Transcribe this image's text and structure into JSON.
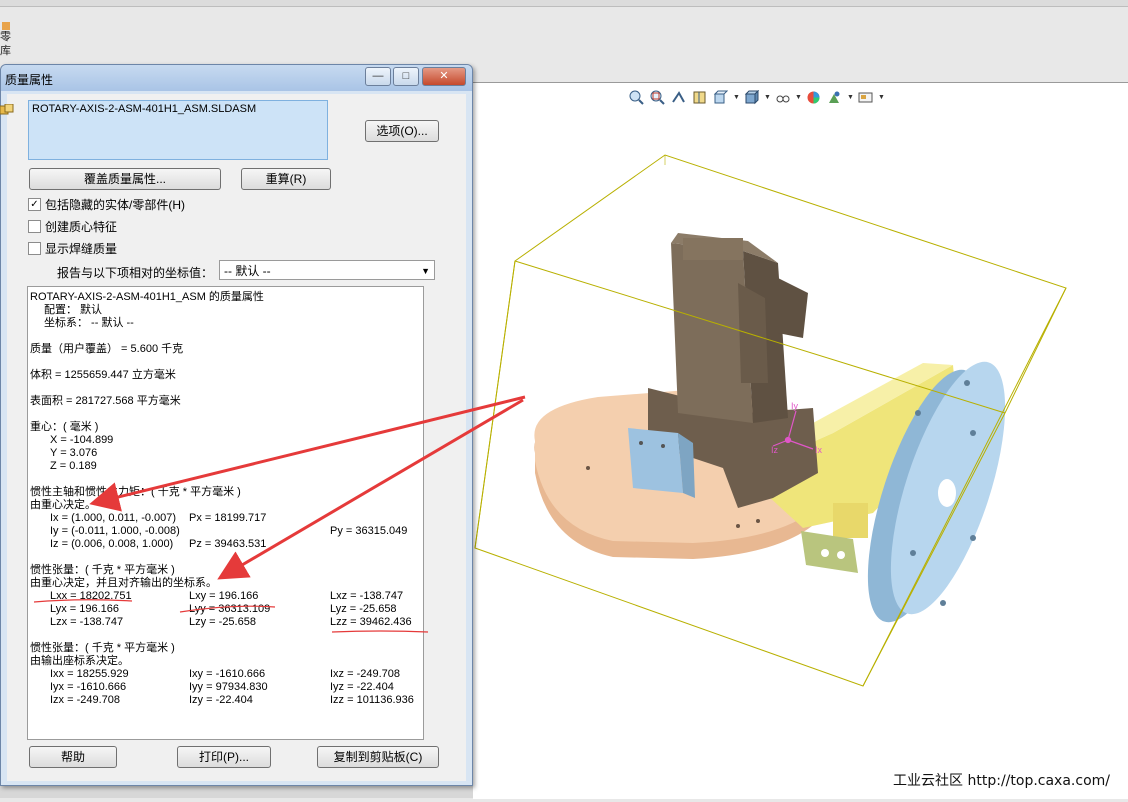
{
  "toolbar_left": {
    "label_line1": "零",
    "label_line2": "库"
  },
  "dialog": {
    "title": "质量属性",
    "window_buttons": {
      "minimize": "—",
      "maximize": "□",
      "close": "✕"
    },
    "selection": {
      "filename": "ROTARY-AXIS-2-ASM-401H1_ASM.SLDASM"
    },
    "buttons": {
      "options": "选项(O)...",
      "override": "覆盖质量属性...",
      "recalc": "重算(R)",
      "help": "帮助",
      "print": "打印(P)...",
      "copy": "复制到剪贴板(C)"
    },
    "checkboxes": [
      {
        "label": "包括隐藏的实体/零部件(H)",
        "checked": true
      },
      {
        "label": "创建质心特征",
        "checked": false
      },
      {
        "label": "显示焊缝质量",
        "checked": false
      }
    ],
    "coord": {
      "label": "报告与以下项相对的坐标值：",
      "value": "-- 默认 --"
    },
    "results": {
      "header": "ROTARY-AXIS-2-ASM-401H1_ASM 的质量属性",
      "config": "配置： 默认",
      "coord_sys": "坐标系： -- 默认 --",
      "mass": "质量（用户覆盖） = 5.600 千克",
      "volume": "体积 = 1255659.447 立方毫米",
      "surface": "表面积 = 281727.568  平方毫米",
      "cog_title": "重心：( 毫米 )",
      "cog_x": "X = -104.899",
      "cog_y": "Y = 3.076",
      "cog_z": "Z = 0.189",
      "principal_title": "惯性主轴和惯性主力矩：( 千克 *  平方毫米 )",
      "principal_sub": "由重心决定。",
      "ix": "Ix = (1.000, 0.011, -0.007)",
      "px": "Px = 18199.717",
      "iy": "Iy = (-0.011, 1.000, -0.008)",
      "py": "Py = 36315.049",
      "iz": "Iz = (0.006, 0.008, 1.000)",
      "pz": "Pz = 39463.531",
      "tensor1_title": "惯性张量：( 千克 *  平方毫米 )",
      "tensor1_sub": "由重心决定，并且对齐输出的坐标系。",
      "t1": [
        [
          "Lxx = 18202.751",
          "Lxy = 196.166",
          "Lxz = -138.747"
        ],
        [
          "Lyx = 196.166",
          "Lyy = 36313.109",
          "Lyz = -25.658"
        ],
        [
          "Lzx = -138.747",
          "Lzy = -25.658",
          "Lzz = 39462.436"
        ]
      ],
      "tensor2_title": "惯性张量：( 千克 *  平方毫米 )",
      "tensor2_sub": "由输出座标系决定。",
      "t2": [
        [
          "Ixx = 18255.929",
          "Ixy = -1610.666",
          "Ixz = -249.708"
        ],
        [
          "Iyx = -1610.666",
          "Iyy = 97934.830",
          "Iyz = -22.404"
        ],
        [
          "Izx = -249.708",
          "Izy = -22.404",
          "Izz = 101136.936"
        ]
      ]
    }
  },
  "viewport": {
    "toolbar_icons": [
      "zoom-to-fit-icon",
      "zoom-to-area-icon",
      "previous-view-icon",
      "section-view-icon",
      "view-orientation-icon",
      "display-style-icon",
      "hide-show-icon",
      "edit-appearance-icon",
      "apply-scene-icon",
      "view-settings-icon"
    ],
    "triad_labels": [
      "Iy",
      "Iz",
      "Ix"
    ],
    "watermark": "工业云社区 http://top.caxa.com/"
  },
  "colors": {
    "base_plate": "#f2c9a6",
    "motor": "#7a6a58",
    "bracket": "#f2e98a",
    "flange": "#a7cbe6",
    "block": "#a9cde6",
    "bbox": "#b8b000",
    "arrow": "#e53a3a",
    "triad": "#e056c8"
  }
}
